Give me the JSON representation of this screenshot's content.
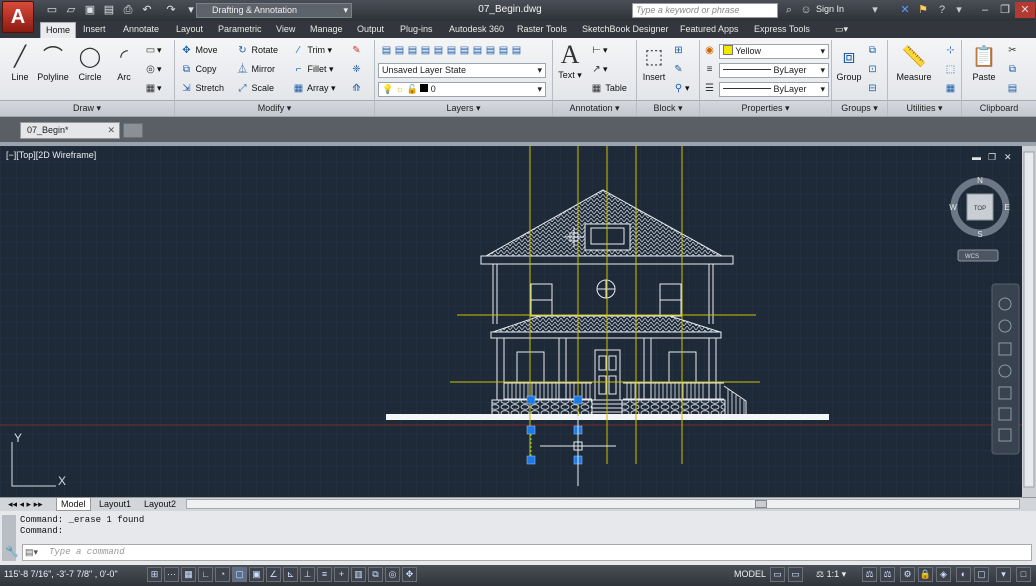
{
  "titlebar": {
    "app_button": "A",
    "workspace": "Drafting & Annotation",
    "title": "07_Begin.dwg",
    "search_placeholder": "Type a keyword or phrase",
    "signin": "Sign In"
  },
  "ribbon_tabs": [
    "Home",
    "Insert",
    "Annotate",
    "Layout",
    "Parametric",
    "View",
    "Manage",
    "Output",
    "Plug-ins",
    "Autodesk 360",
    "Raster Tools",
    "SketchBook Designer",
    "Featured Apps",
    "Express Tools"
  ],
  "draw": {
    "line": "Line",
    "polyline": "Polyline",
    "circle": "Circle",
    "arc": "Arc",
    "panel": "Draw"
  },
  "modify": {
    "move": "Move",
    "rotate": "Rotate",
    "trim": "Trim",
    "copy": "Copy",
    "mirror": "Mirror",
    "fillet": "Fillet",
    "stretch": "Stretch",
    "scale": "Scale",
    "array": "Array",
    "panel": "Modify"
  },
  "layers": {
    "state": "Unsaved Layer State",
    "current": "0",
    "panel": "Layers"
  },
  "annotation": {
    "text": "Text",
    "table": "Table",
    "panel": "Annotation"
  },
  "block": {
    "insert": "Insert",
    "panel": "Block"
  },
  "properties": {
    "color": "Yellow",
    "linetype": "ByLayer",
    "lineweight": "ByLayer",
    "panel": "Properties",
    "color_swatch": "#f5e600"
  },
  "groups": {
    "group": "Group",
    "panel": "Groups"
  },
  "utilities": {
    "measure": "Measure",
    "panel": "Utilities"
  },
  "clipboard": {
    "paste": "Paste",
    "panel": "Clipboard"
  },
  "doc_tab": "07_Begin*",
  "viewport": {
    "label": "[−][Top][2D Wireframe]",
    "viewcube_top": "TOP",
    "compass": {
      "n": "N",
      "s": "S",
      "e": "E",
      "w": "W"
    },
    "wcs": "WCS",
    "ucs_x": "X",
    "ucs_y": "Y"
  },
  "layout_tabs": [
    "Model",
    "Layout1",
    "Layout2"
  ],
  "command": {
    "history": [
      "Command: _erase 1 found",
      "Command:"
    ],
    "placeholder": "Type a command"
  },
  "status": {
    "coords": "115'-8 7/16\", -3'-7 7/8\" , 0'-0\"",
    "model": "MODEL",
    "scale": "1:1"
  }
}
